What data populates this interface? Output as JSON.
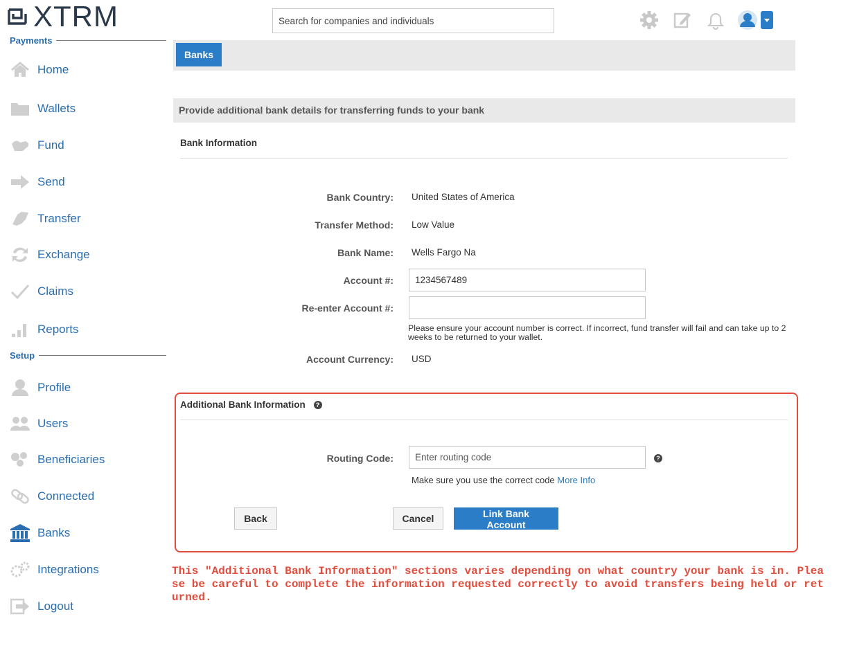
{
  "app": {
    "brand": "XTRM"
  },
  "header": {
    "search_placeholder": "Search for companies and individuals",
    "icons": [
      "gear-icon",
      "edit-icon",
      "bell-icon",
      "user-avatar-icon",
      "caret-down-icon"
    ]
  },
  "sidebar": {
    "payments_title": "Payments",
    "setup_title": "Setup",
    "payments_items": [
      {
        "label": "Home",
        "icon": "home-icon"
      },
      {
        "label": "Wallets",
        "icon": "folder-icon"
      },
      {
        "label": "Fund",
        "icon": "fund-icon"
      },
      {
        "label": "Send",
        "icon": "arrow-right-icon"
      },
      {
        "label": "Transfer",
        "icon": "transfer-icon"
      },
      {
        "label": "Exchange",
        "icon": "exchange-icon"
      },
      {
        "label": "Claims",
        "icon": "checkmark-icon"
      },
      {
        "label": "Reports",
        "icon": "bar-chart-icon"
      }
    ],
    "setup_items": [
      {
        "label": "Profile",
        "icon": "user-icon"
      },
      {
        "label": "Users",
        "icon": "users-icon"
      },
      {
        "label": "Beneficiaries",
        "icon": "beneficiaries-icon"
      },
      {
        "label": "Connected",
        "icon": "link-icon"
      },
      {
        "label": "Banks",
        "icon": "bank-icon",
        "active": true
      },
      {
        "label": "Integrations",
        "icon": "cogs-icon"
      },
      {
        "label": "Logout",
        "icon": "logout-icon"
      }
    ]
  },
  "tabs": {
    "active": "Banks"
  },
  "main": {
    "panel_title": "Provide additional bank details for transferring funds to your bank",
    "bank_info": {
      "title": "Bank Information",
      "bank_country_label": "Bank Country:",
      "bank_country_value": "United States of America",
      "transfer_method_label": "Transfer Method:",
      "transfer_method_value": "Low Value",
      "bank_name_label": "Bank Name:",
      "bank_name_value": "Wells Fargo Na",
      "account_label": "Account #:",
      "account_value": "1234567489",
      "reenter_label": "Re-enter Account #:",
      "reenter_value": "",
      "account_note": "Please ensure your account number is correct. If incorrect, fund transfer will fail and can take up to 2 weeks to be returned to your wallet.",
      "currency_label": "Account Currency:",
      "currency_value": "USD"
    },
    "additional": {
      "title": "Additional Bank Information",
      "routing_label": "Routing Code:",
      "routing_placeholder": "Enter routing code",
      "routing_note": "Make sure you use the correct code",
      "more_info_link": "More Info"
    },
    "buttons": {
      "back": "Back",
      "cancel": "Cancel",
      "link": "Link Bank Account"
    }
  },
  "annotation": "This \"Additional Bank Information\" sections varies depending on what country your bank is in. Please be careful to complete the information requested correctly to avoid transfers being held or returned.",
  "colors": {
    "accent": "#2a7dc6",
    "annotation_red": "#e24c3c",
    "panel_gray": "#e9e9e9"
  }
}
